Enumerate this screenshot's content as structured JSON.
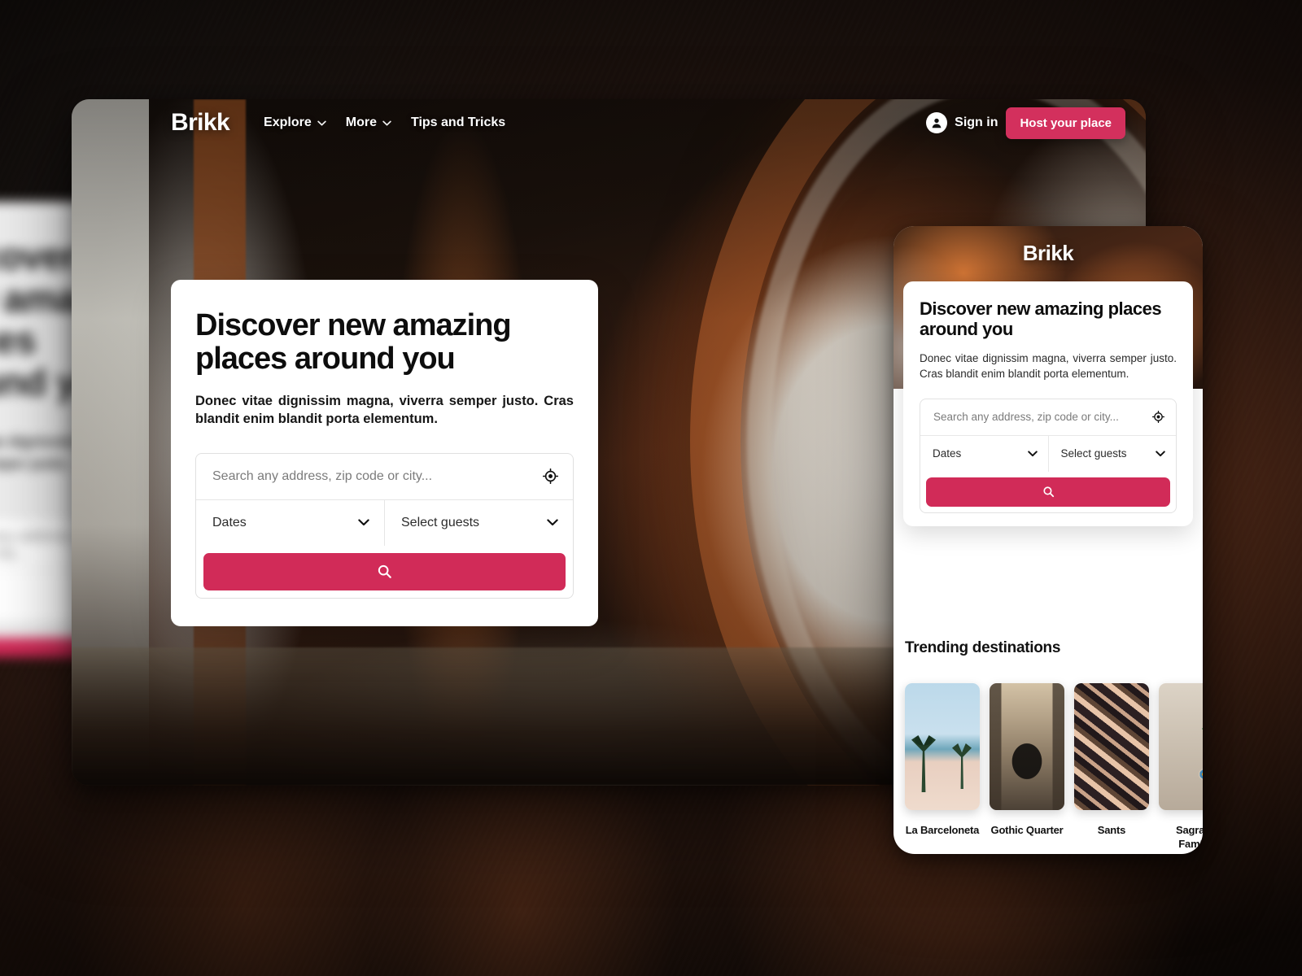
{
  "brand": "Brikk",
  "desktop": {
    "nav": {
      "links": [
        {
          "label": "Explore",
          "has_chevron": true,
          "icon": "chevron-down-icon"
        },
        {
          "label": "More",
          "has_chevron": true,
          "icon": "chevron-down-icon"
        },
        {
          "label": "Tips and Tricks",
          "has_chevron": false,
          "icon": ""
        }
      ],
      "sign_in": "Sign in",
      "sign_in_icon": "user-circle-icon",
      "host_button": "Host your place"
    },
    "hero": {
      "heading": "Discover new amazing places around you",
      "subheading": "Donec vitae dignissim magna, viverra semper justo. Cras blandit enim blandit porta elementum."
    },
    "search": {
      "address_placeholder": "Search any address, zip code or city...",
      "address_value": "",
      "geolocate_icon": "crosshair-location-icon",
      "dates_label": "Dates",
      "guests_label": "Select guests",
      "dropdown_icon": "chevron-down-icon",
      "submit_icon": "search-icon",
      "submit_label": ""
    }
  },
  "mobile": {
    "brand": "Brikk",
    "hero": {
      "heading": "Discover new amazing places around you",
      "subheading": "Donec vitae dignissim magna, viverra semper justo. Cras blandit enim blandit porta elementum."
    },
    "search": {
      "address_placeholder": "Search any address, zip code or city...",
      "address_value": "",
      "geolocate_icon": "crosshair-location-icon",
      "dates_label": "Dates",
      "guests_label": "Select guests",
      "dropdown_icon": "chevron-down-icon",
      "submit_icon": "search-icon"
    },
    "trending": {
      "title": "Trending destinations",
      "items": [
        {
          "label": "La Barceloneta",
          "art": "beach"
        },
        {
          "label": "Gothic Quarter",
          "art": "gothic"
        },
        {
          "label": "Sants",
          "art": "sants"
        },
        {
          "label": "Sagrada Família",
          "art": "sagrada"
        }
      ]
    }
  },
  "ghost": {
    "heading": "Discover new amazing places around you",
    "subheading": "Donec vitae dignissim magna, viverra semper justo.",
    "address_placeholder": "Search any address, zip code or city...",
    "dates_label": "Dates"
  },
  "colors": {
    "accent": "#d12b58",
    "accent_button": "#d3305d",
    "text_dark": "#0d0d0d",
    "placeholder": "#7b7b7b",
    "card_bg": "#ffffff"
  }
}
